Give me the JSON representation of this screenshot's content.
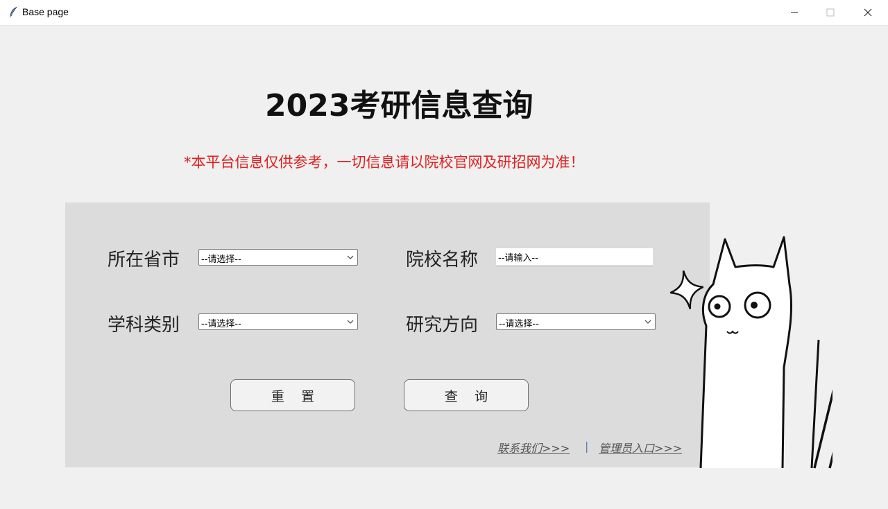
{
  "window": {
    "title": "Base page"
  },
  "heading": "2023考研信息查询",
  "notice": "*本平台信息仅供参考，一切信息请以院校官网及研招网为准！",
  "form": {
    "province_label": "所在省市",
    "province_value": "--请选择--",
    "school_label": "院校名称",
    "school_placeholder": "--请输入--",
    "subject_label": "学科类别",
    "subject_value": "--请选择--",
    "direction_label": "研究方向",
    "direction_value": "--请选择--"
  },
  "buttons": {
    "reset": "重    置",
    "query": "查    询"
  },
  "links": {
    "contact": "联系我们>>>",
    "separator": "|",
    "admin": "管理员入口>>>"
  },
  "icons": [
    "feather-icon",
    "minimize-icon",
    "maximize-icon",
    "close-icon",
    "chevron-down-icon",
    "cat-mascot"
  ]
}
